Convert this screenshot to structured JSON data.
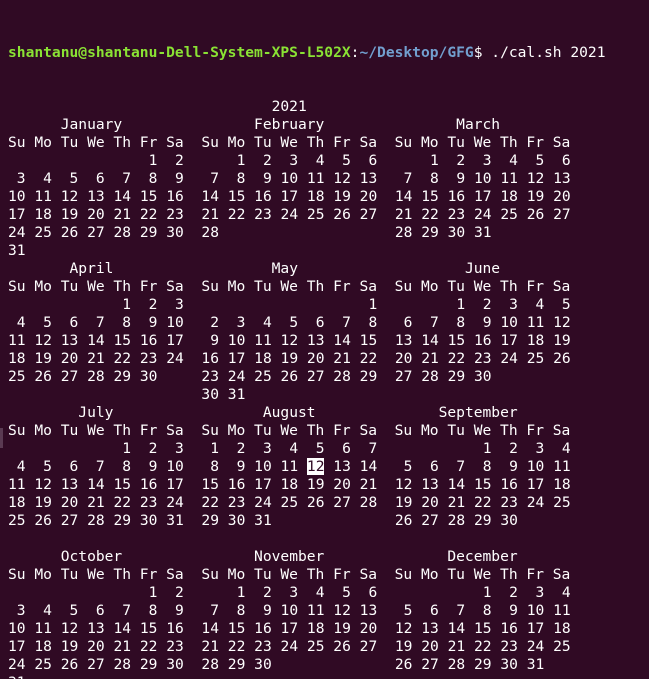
{
  "prompt": {
    "user_host": "shantanu@shantanu-Dell-System-XPS-L502X",
    "colon": ":",
    "path": "~/Desktop/GFG",
    "dollar": "$ ",
    "command": "./cal.sh 2021"
  },
  "colors": {
    "background": "#300a24",
    "foreground": "#ffffff",
    "user_host": "#8ae234",
    "path": "#729fcf"
  },
  "calendar": {
    "year": "2021",
    "highlight": {
      "month": "August",
      "day": "12"
    },
    "rows": [
      {
        "headers": [
          "January",
          "February",
          "March"
        ],
        "months": [
          {
            "name": "January",
            "start": 5,
            "days": 31
          },
          {
            "name": "February",
            "start": 1,
            "days": 28
          },
          {
            "name": "March",
            "start": 1,
            "days": 31
          }
        ]
      },
      {
        "headers": [
          "April",
          "May",
          "June"
        ],
        "months": [
          {
            "name": "April",
            "start": 4,
            "days": 30
          },
          {
            "name": "May",
            "start": 6,
            "days": 31
          },
          {
            "name": "June",
            "start": 2,
            "days": 30
          }
        ]
      },
      {
        "headers": [
          "July",
          "August",
          "September"
        ],
        "months": [
          {
            "name": "July",
            "start": 4,
            "days": 31
          },
          {
            "name": "August",
            "start": 0,
            "days": 31
          },
          {
            "name": "September",
            "start": 3,
            "days": 30
          }
        ]
      },
      {
        "headers": [
          "October",
          "November",
          "December"
        ],
        "months": [
          {
            "name": "October",
            "start": 5,
            "days": 31
          },
          {
            "name": "November",
            "start": 1,
            "days": 30
          },
          {
            "name": "December",
            "start": 3,
            "days": 31
          }
        ]
      }
    ],
    "weekday_header": "Su Mo Tu We Th Fr Sa"
  }
}
